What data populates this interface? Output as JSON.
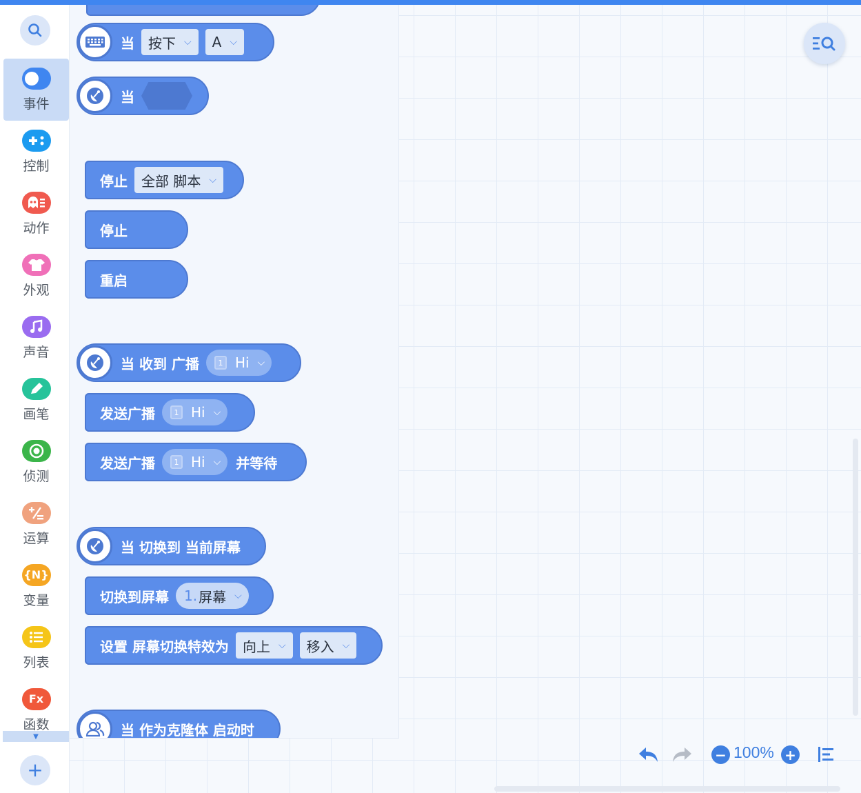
{
  "categories": [
    {
      "label": "事件",
      "icon": "toggle-icon",
      "color": "#3f86f0",
      "active": true
    },
    {
      "label": "控制",
      "icon": "gamepad-icon",
      "color": "#1c9bf0"
    },
    {
      "label": "动作",
      "icon": "ghost-icon",
      "color": "#f05a4f"
    },
    {
      "label": "外观",
      "icon": "tshirt-icon",
      "color": "#f070b8"
    },
    {
      "label": "声音",
      "icon": "music-note-icon",
      "color": "#9a6cf0"
    },
    {
      "label": "画笔",
      "icon": "pen-icon",
      "color": "#26c39a"
    },
    {
      "label": "侦测",
      "icon": "target-icon",
      "color": "#3bb54a"
    },
    {
      "label": "运算",
      "icon": "math-ops-icon",
      "color": "#f0a27e"
    },
    {
      "label": "变量",
      "icon": "variable-icon",
      "color": "#f5a623",
      "glyph": "{N}"
    },
    {
      "label": "列表",
      "icon": "list-icon",
      "color": "#f5c518"
    },
    {
      "label": "函数",
      "icon": "function-icon",
      "color": "#f0583a",
      "glyph": "Fx"
    }
  ],
  "blocks": {
    "when_key": {
      "word": "当",
      "action": "按下",
      "key": "A"
    },
    "when_signal": {
      "word": "当"
    },
    "stop_scope": {
      "label": "停止",
      "scope": "全部 脚本"
    },
    "stop": {
      "label": "停止"
    },
    "restart": {
      "label": "重启"
    },
    "when_receive": {
      "label": "当 收到 广播",
      "badge": "1",
      "message": "Hi"
    },
    "broadcast": {
      "label": "发送广播",
      "badge": "1",
      "message": "Hi"
    },
    "broadcast_wait": {
      "label": "发送广播",
      "badge": "1",
      "message": "Hi",
      "suffix": "并等待"
    },
    "when_screen": {
      "label": "当 切换到 当前屏幕"
    },
    "switch_screen": {
      "label": "切换到屏幕",
      "index": "1.",
      "screen": "屏幕"
    },
    "set_effect": {
      "label": "设置 屏幕切换特效为",
      "direction": "向上",
      "effect": "移入"
    },
    "when_clone": {
      "label": "当 作为克隆体 启动时"
    }
  },
  "canvas": {
    "zoom": "100%"
  }
}
